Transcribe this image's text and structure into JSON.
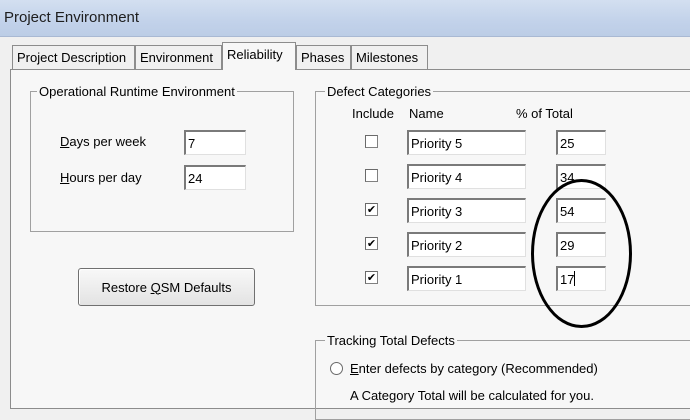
{
  "window": {
    "title": "Project Environment"
  },
  "tabs": [
    {
      "label": "Project Description",
      "active": false
    },
    {
      "label": "Environment",
      "active": false
    },
    {
      "label": "Reliability",
      "active": true
    },
    {
      "label": "Phases",
      "active": false
    },
    {
      "label": "Milestones",
      "active": false
    }
  ],
  "runtime": {
    "legend": "Operational Runtime Environment",
    "days_label_mnemonic": "D",
    "days_label_rest": "ays per week",
    "days_value": "7",
    "hours_label_mnemonic": "H",
    "hours_label_rest": "ours per day",
    "hours_value": "24"
  },
  "restore_button": {
    "pre": "Restore ",
    "mnemonic": "Q",
    "post": "SM Defaults"
  },
  "defects": {
    "legend": "Defect Categories",
    "col_include": "Include",
    "col_name": "Name",
    "col_percent": "% of Total",
    "rows": [
      {
        "name": "Priority 5",
        "percent": "25",
        "included": false,
        "check": ""
      },
      {
        "name": "Priority 4",
        "percent": "34",
        "included": false,
        "check": ""
      },
      {
        "name": "Priority 3",
        "percent": "54",
        "included": true,
        "check": "✔"
      },
      {
        "name": "Priority 2",
        "percent": "29",
        "included": true,
        "check": "✔"
      },
      {
        "name": "Priority 1",
        "percent": "17",
        "included": true,
        "check": "✔"
      }
    ]
  },
  "tracking": {
    "legend": "Tracking Total Defects",
    "option_mnemonic": "E",
    "option_rest": "nter defects by category  (Recommended)",
    "note": "A Category Total will be calculated for you."
  },
  "annotation": {
    "shape": "hand-drawn-ellipse",
    "color": "#000000"
  }
}
